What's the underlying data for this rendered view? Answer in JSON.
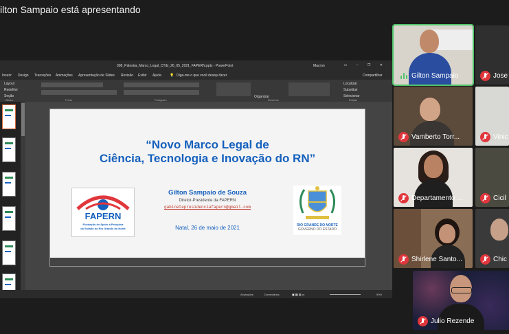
{
  "banner": "ilton Sampaio está apresentando",
  "ppt": {
    "window_title": "008_Palestra_Marco_Legal_CT&I_26_05_2021_FAPERN.pptx - PowerPoint",
    "user": "Macron",
    "menu": [
      "Inserir",
      "Design",
      "Transições",
      "Animações",
      "Apresentação de Slides",
      "Revisão",
      "Exibir",
      "Ajuda"
    ],
    "search_hint": "Diga-me o que você deseja fazer",
    "share": "Compartilhar",
    "groups": [
      "Slides",
      "Fonte",
      "Parágrafo",
      "Desenho",
      "Edição"
    ],
    "layout_label": "Layout",
    "reset_label": "Redefinir",
    "section_label": "Seção",
    "arrange_label": "Organizar",
    "find_label": "Localizar",
    "replace_label": "Substituir",
    "select_label": "Selecionar",
    "status_notes": "Anotações",
    "status_comments": "Comentários",
    "zoom": "90%"
  },
  "slide": {
    "title_line1": "“Novo Marco Legal de",
    "title_line2": "Ciência, Tecnologia e Inovação do RN”",
    "presenter": "Gilton Sampaio de Souza",
    "role": "Diretor-Presidente da FAPERN",
    "email": "gabinetepresidenciafapern@gmail.com",
    "date": "Natal, 26 de maio de 2021",
    "fapern_name": "FAPERN",
    "fapern_sub1": "Fundação de Apoio à Pesquisa",
    "fapern_sub2": "do Estado do Rio Grande do Norte",
    "rn_label1": "RIO GRANDE DO NORTE",
    "rn_label2": "GOVERNO DO ESTADO"
  },
  "participants": [
    {
      "name": "Gilton Sampaio"
    },
    {
      "name": "Jose"
    },
    {
      "name": "Vamberto Torr..."
    },
    {
      "name": "Vinic"
    },
    {
      "name": "Departamento ..."
    },
    {
      "name": "Cicil"
    },
    {
      "name": "Shirlene Santo..."
    },
    {
      "name": "Chic"
    },
    {
      "name": "Julio Rezende"
    }
  ],
  "colors": {
    "accent_blue": "#1560bd",
    "muted_red": "#e0363c",
    "speaking_green": "#4fc36a"
  }
}
